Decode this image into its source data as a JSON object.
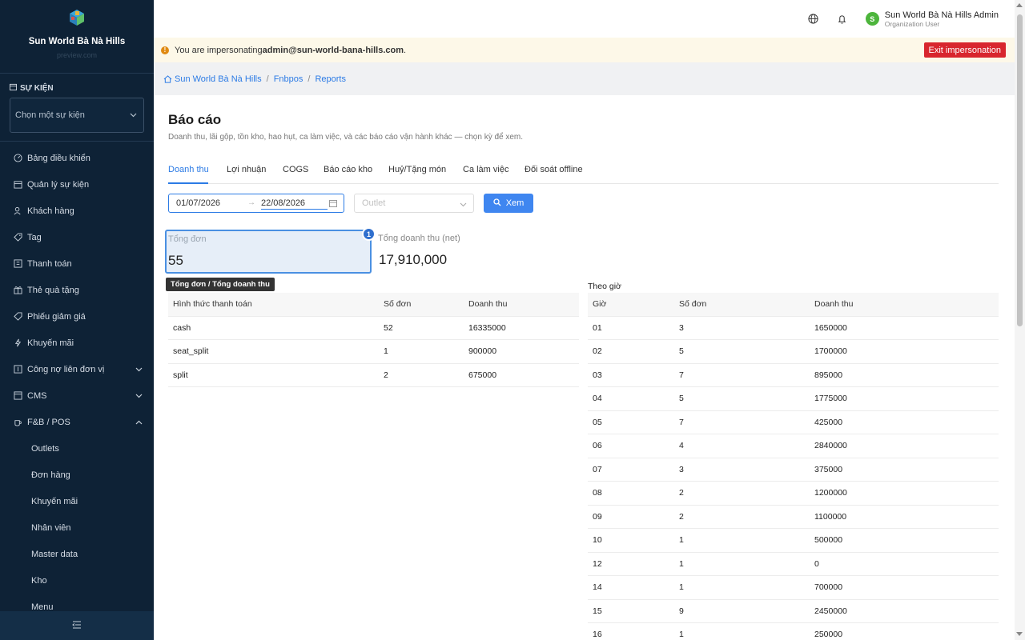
{
  "sidebar": {
    "brand_name": "Sun World Bà Nà Hills",
    "brand_sub": "preview.com",
    "event_section_label": "SỰ KIỆN",
    "event_placeholder": "Chọn một sự kiện",
    "items": [
      {
        "label": "Bảng điều khiển",
        "icon": "dashboard-icon"
      },
      {
        "label": "Quản lý sự kiện",
        "icon": "calendar-icon"
      },
      {
        "label": "Khách hàng",
        "icon": "users-icon"
      },
      {
        "label": "Tag",
        "icon": "tag-icon"
      },
      {
        "label": "Thanh toán",
        "icon": "payment-icon"
      },
      {
        "label": "Thẻ quà tặng",
        "icon": "gift-icon"
      },
      {
        "label": "Phiếu giảm giá",
        "icon": "coupon-icon"
      },
      {
        "label": "Khuyến mãi",
        "icon": "lightning-icon"
      },
      {
        "label": "Công nợ liên đơn vị",
        "icon": "ledger-icon"
      },
      {
        "label": "CMS",
        "icon": "cms-icon"
      },
      {
        "label": "F&B / POS",
        "icon": "coffee-icon"
      }
    ],
    "sub_items": [
      "Outlets",
      "Đơn hàng",
      "Khuyến mãi",
      "Nhân viên",
      "Master data",
      "Kho",
      "Menu"
    ]
  },
  "topbar": {
    "user_initial": "S",
    "user_name": "Sun World Bà Nà Hills Admin",
    "user_role": "Organization User"
  },
  "banner": {
    "prefix": "You are impersonating ",
    "email": "admin@sun-world-bana-hills.com",
    "suffix": ".",
    "exit_label": "Exit impersonation"
  },
  "breadcrumb": [
    "Sun World Bà Nà Hills",
    "Fnbpos",
    "Reports"
  ],
  "page": {
    "title": "Báo cáo",
    "description": "Doanh thu, lãi gộp, tồn kho, hao hụt, ca làm việc, và các báo cáo vận hành khác — chọn kỳ để xem."
  },
  "tabs": [
    "Doanh thu",
    "Lợi nhuận",
    "COGS",
    "Báo cáo kho",
    "Huỷ/Tặng món",
    "Ca làm việc",
    "Đối soát offline"
  ],
  "active_tab": 0,
  "filters": {
    "date_start": "01/07/2026",
    "date_end": "22/08/2026",
    "outlet_placeholder": "Outlet",
    "submit_label": "Xem"
  },
  "stats": {
    "orders_label": "Tổng đơn",
    "orders_value": "55",
    "badge": "1",
    "revenue_label": "Tổng doanh thu (net)",
    "revenue_value": "17,910,000",
    "tooltip": "Tổng đơn / Tổng doanh thu"
  },
  "payment_table": {
    "headers": [
      "Hình thức thanh toán",
      "Số đơn",
      "Doanh thu"
    ],
    "rows": [
      [
        "cash",
        "52",
        "16335000"
      ],
      [
        "seat_split",
        "1",
        "900000"
      ],
      [
        "split",
        "2",
        "675000"
      ]
    ]
  },
  "hourly_table": {
    "title": "Theo giờ",
    "headers": [
      "Giờ",
      "Số đơn",
      "Doanh thu"
    ],
    "rows": [
      [
        "01",
        "3",
        "1650000"
      ],
      [
        "02",
        "5",
        "1700000"
      ],
      [
        "03",
        "7",
        "895000"
      ],
      [
        "04",
        "5",
        "1775000"
      ],
      [
        "05",
        "7",
        "425000"
      ],
      [
        "06",
        "4",
        "2840000"
      ],
      [
        "07",
        "3",
        "375000"
      ],
      [
        "08",
        "2",
        "1200000"
      ],
      [
        "09",
        "2",
        "1100000"
      ],
      [
        "10",
        "1",
        "500000"
      ],
      [
        "12",
        "1",
        "0"
      ],
      [
        "14",
        "1",
        "700000"
      ],
      [
        "15",
        "9",
        "2450000"
      ],
      [
        "16",
        "1",
        "250000"
      ]
    ]
  }
}
